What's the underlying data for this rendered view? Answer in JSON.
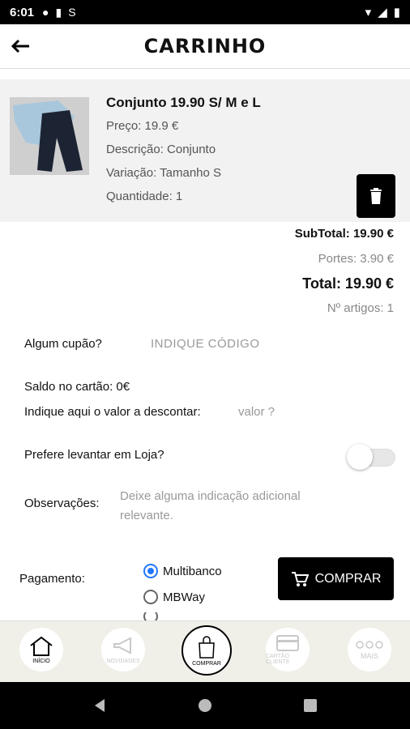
{
  "status": {
    "time": "6:01"
  },
  "header": {
    "title": "CARRINHO"
  },
  "item": {
    "name": "Conjunto 19.90 S/ M e L",
    "price": "Preço: 19.9 €",
    "description": "Descrição: Conjunto",
    "variation": "Variação: Tamanho S",
    "quantity": "Quantidade: 1"
  },
  "totals": {
    "subtotal": "SubTotal: 19.90 €",
    "portes": "Portes: 3.90 €",
    "total": "Total: 19.90 €",
    "count": "Nº artigos: 1"
  },
  "form": {
    "coupon_label": "Algum cupão?",
    "coupon_placeholder": "INDIQUE CÓDIGO",
    "balance": "Saldo no cartão: 0€",
    "discount_label": "Indique aqui o valor a descontar:",
    "discount_placeholder": "valor ?",
    "pickup_label": "Prefere levantar em Loja?",
    "notes_label": "Observações:",
    "notes_placeholder_1": "Deixe alguma indicação adicional",
    "notes_placeholder_2": "relevante."
  },
  "payment": {
    "label": "Pagamento:",
    "options": [
      "Multibanco",
      "MBWay"
    ],
    "buy_label": "COMPRAR"
  },
  "nav": {
    "inicio": "INÍCIO",
    "novidades": "NOVIDADES",
    "comprar": "COMPRAR",
    "cartao": "CARTÃO CLIENTE",
    "mais": "MAIS"
  }
}
